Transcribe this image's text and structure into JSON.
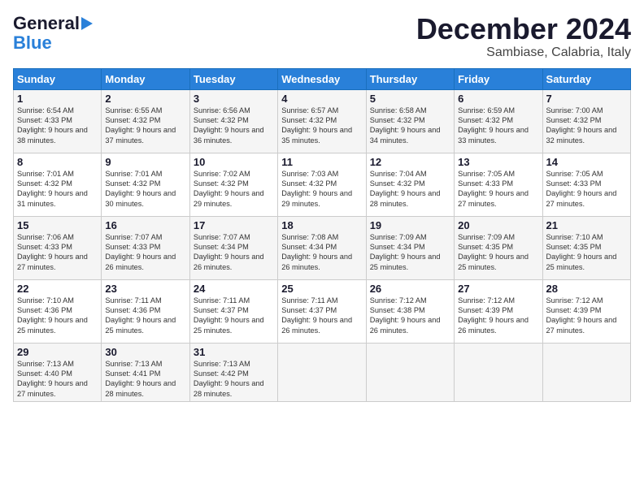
{
  "header": {
    "logo_line1": "General",
    "logo_line2": "Blue",
    "month": "December 2024",
    "location": "Sambiase, Calabria, Italy"
  },
  "days_of_week": [
    "Sunday",
    "Monday",
    "Tuesday",
    "Wednesday",
    "Thursday",
    "Friday",
    "Saturday"
  ],
  "weeks": [
    [
      {
        "day": "1",
        "sunrise": "6:54 AM",
        "sunset": "4:33 PM",
        "daylight": "9 hours and 38 minutes."
      },
      {
        "day": "2",
        "sunrise": "6:55 AM",
        "sunset": "4:32 PM",
        "daylight": "9 hours and 37 minutes."
      },
      {
        "day": "3",
        "sunrise": "6:56 AM",
        "sunset": "4:32 PM",
        "daylight": "9 hours and 36 minutes."
      },
      {
        "day": "4",
        "sunrise": "6:57 AM",
        "sunset": "4:32 PM",
        "daylight": "9 hours and 35 minutes."
      },
      {
        "day": "5",
        "sunrise": "6:58 AM",
        "sunset": "4:32 PM",
        "daylight": "9 hours and 34 minutes."
      },
      {
        "day": "6",
        "sunrise": "6:59 AM",
        "sunset": "4:32 PM",
        "daylight": "9 hours and 33 minutes."
      },
      {
        "day": "7",
        "sunrise": "7:00 AM",
        "sunset": "4:32 PM",
        "daylight": "9 hours and 32 minutes."
      }
    ],
    [
      {
        "day": "8",
        "sunrise": "7:01 AM",
        "sunset": "4:32 PM",
        "daylight": "9 hours and 31 minutes."
      },
      {
        "day": "9",
        "sunrise": "7:01 AM",
        "sunset": "4:32 PM",
        "daylight": "9 hours and 30 minutes."
      },
      {
        "day": "10",
        "sunrise": "7:02 AM",
        "sunset": "4:32 PM",
        "daylight": "9 hours and 29 minutes."
      },
      {
        "day": "11",
        "sunrise": "7:03 AM",
        "sunset": "4:32 PM",
        "daylight": "9 hours and 29 minutes."
      },
      {
        "day": "12",
        "sunrise": "7:04 AM",
        "sunset": "4:32 PM",
        "daylight": "9 hours and 28 minutes."
      },
      {
        "day": "13",
        "sunrise": "7:05 AM",
        "sunset": "4:33 PM",
        "daylight": "9 hours and 27 minutes."
      },
      {
        "day": "14",
        "sunrise": "7:05 AM",
        "sunset": "4:33 PM",
        "daylight": "9 hours and 27 minutes."
      }
    ],
    [
      {
        "day": "15",
        "sunrise": "7:06 AM",
        "sunset": "4:33 PM",
        "daylight": "9 hours and 27 minutes."
      },
      {
        "day": "16",
        "sunrise": "7:07 AM",
        "sunset": "4:33 PM",
        "daylight": "9 hours and 26 minutes."
      },
      {
        "day": "17",
        "sunrise": "7:07 AM",
        "sunset": "4:34 PM",
        "daylight": "9 hours and 26 minutes."
      },
      {
        "day": "18",
        "sunrise": "7:08 AM",
        "sunset": "4:34 PM",
        "daylight": "9 hours and 26 minutes."
      },
      {
        "day": "19",
        "sunrise": "7:09 AM",
        "sunset": "4:34 PM",
        "daylight": "9 hours and 25 minutes."
      },
      {
        "day": "20",
        "sunrise": "7:09 AM",
        "sunset": "4:35 PM",
        "daylight": "9 hours and 25 minutes."
      },
      {
        "day": "21",
        "sunrise": "7:10 AM",
        "sunset": "4:35 PM",
        "daylight": "9 hours and 25 minutes."
      }
    ],
    [
      {
        "day": "22",
        "sunrise": "7:10 AM",
        "sunset": "4:36 PM",
        "daylight": "9 hours and 25 minutes."
      },
      {
        "day": "23",
        "sunrise": "7:11 AM",
        "sunset": "4:36 PM",
        "daylight": "9 hours and 25 minutes."
      },
      {
        "day": "24",
        "sunrise": "7:11 AM",
        "sunset": "4:37 PM",
        "daylight": "9 hours and 25 minutes."
      },
      {
        "day": "25",
        "sunrise": "7:11 AM",
        "sunset": "4:37 PM",
        "daylight": "9 hours and 26 minutes."
      },
      {
        "day": "26",
        "sunrise": "7:12 AM",
        "sunset": "4:38 PM",
        "daylight": "9 hours and 26 minutes."
      },
      {
        "day": "27",
        "sunrise": "7:12 AM",
        "sunset": "4:39 PM",
        "daylight": "9 hours and 26 minutes."
      },
      {
        "day": "28",
        "sunrise": "7:12 AM",
        "sunset": "4:39 PM",
        "daylight": "9 hours and 27 minutes."
      }
    ],
    [
      {
        "day": "29",
        "sunrise": "7:13 AM",
        "sunset": "4:40 PM",
        "daylight": "9 hours and 27 minutes."
      },
      {
        "day": "30",
        "sunrise": "7:13 AM",
        "sunset": "4:41 PM",
        "daylight": "9 hours and 28 minutes."
      },
      {
        "day": "31",
        "sunrise": "7:13 AM",
        "sunset": "4:42 PM",
        "daylight": "9 hours and 28 minutes."
      },
      null,
      null,
      null,
      null
    ]
  ]
}
